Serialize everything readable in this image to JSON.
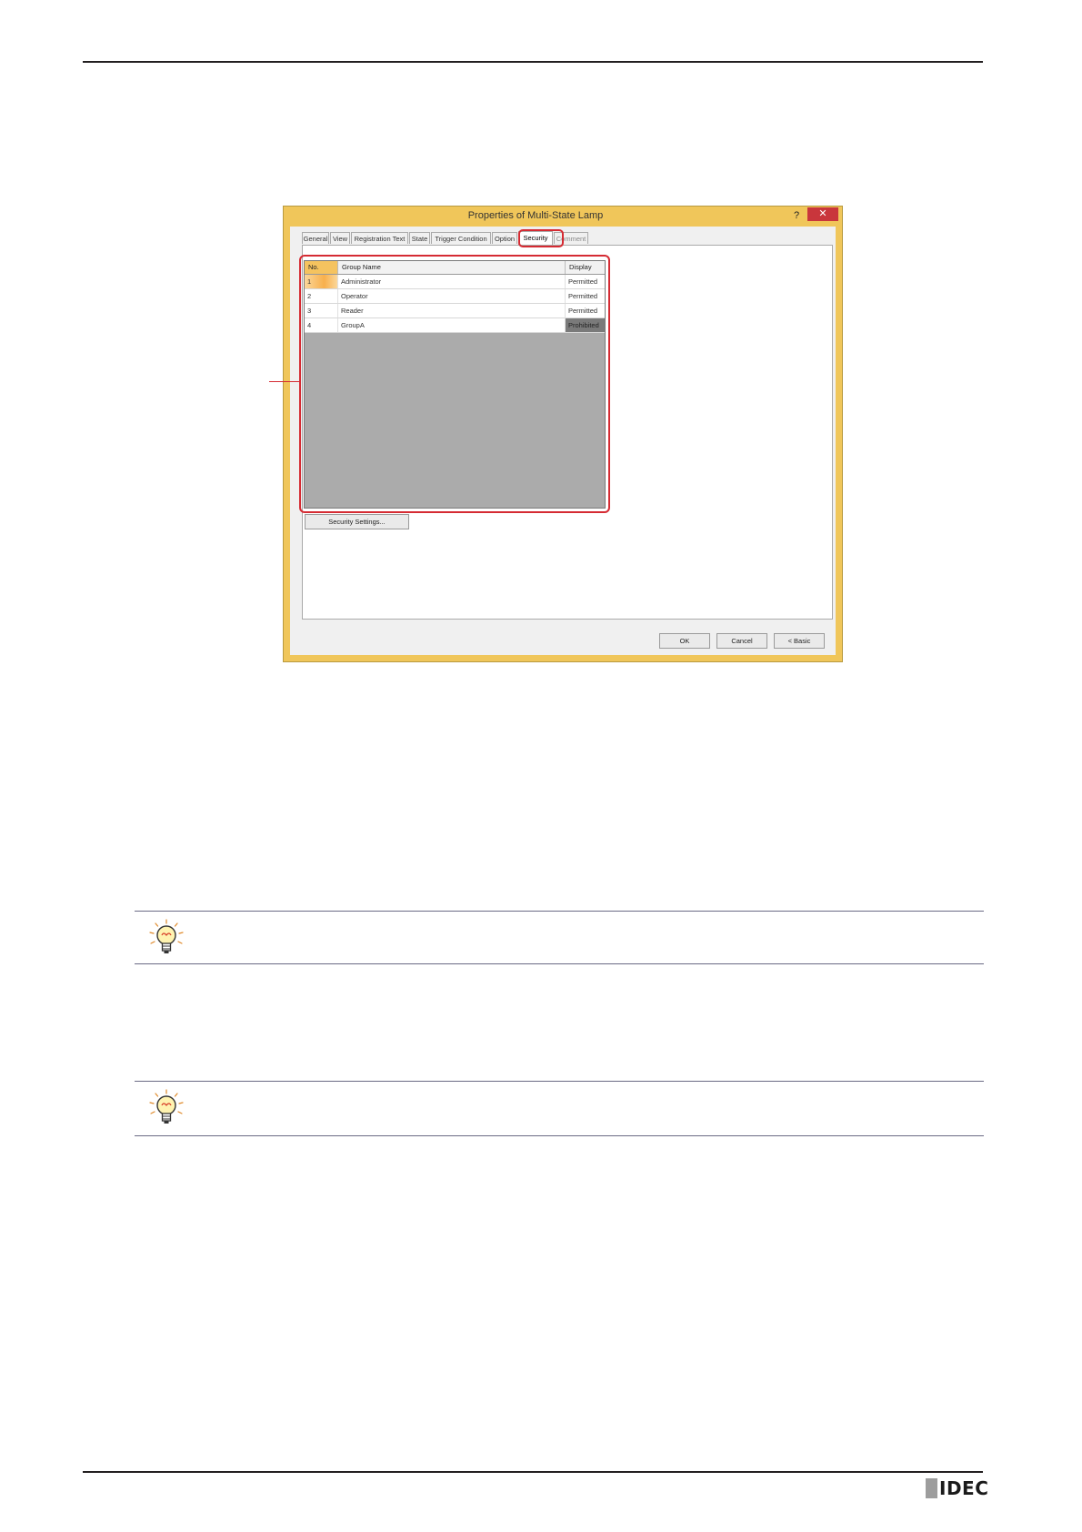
{
  "dialog": {
    "title": "Properties of Multi-State Lamp",
    "help_label": "?",
    "close_label": "✕",
    "tabs": [
      {
        "label": "General"
      },
      {
        "label": "View"
      },
      {
        "label": "Registration Text"
      },
      {
        "label": "State"
      },
      {
        "label": "Trigger Condition"
      },
      {
        "label": "Option"
      },
      {
        "label": "Security"
      },
      {
        "label": "Comment"
      }
    ],
    "active_tab": "Security",
    "grid": {
      "columns": [
        "No.",
        "Group Name",
        "Display"
      ],
      "rows": [
        {
          "no": "1",
          "group": "Administrator",
          "display": "Permitted"
        },
        {
          "no": "2",
          "group": "Operator",
          "display": "Permitted"
        },
        {
          "no": "3",
          "group": "Reader",
          "display": "Permitted"
        },
        {
          "no": "4",
          "group": "GroupA",
          "display": "Prohibited"
        }
      ]
    },
    "security_settings_label": "Security Settings...",
    "ok_label": "OK",
    "cancel_label": "Cancel",
    "basic_label": "< Basic"
  },
  "highlight_color": "#d52b33",
  "title_bar_color": "#f0c65a",
  "icons": [
    "hint-lightbulb-icon",
    "hint-lightbulb-icon"
  ],
  "footer": {
    "logo_text": "IDEC"
  }
}
